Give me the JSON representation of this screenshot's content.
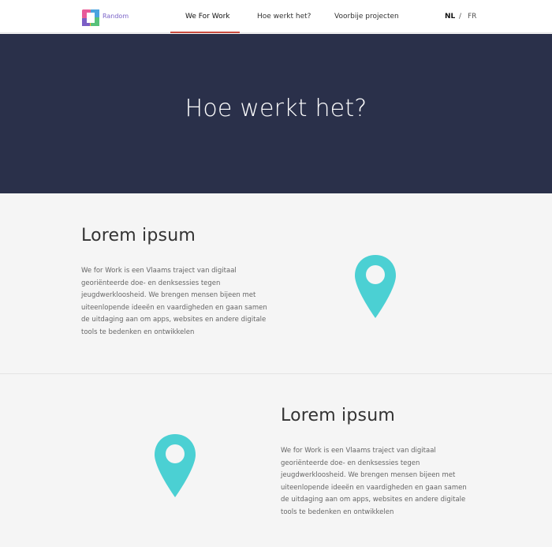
{
  "header": {
    "brand": "Random",
    "nav": [
      {
        "label": "We For Work"
      },
      {
        "label": "Hoe werkt het?"
      },
      {
        "label": "Voorbije projecten"
      }
    ],
    "languages": {
      "nl": "NL",
      "separator": "/",
      "fr": "FR"
    }
  },
  "hero": {
    "title": "Hoe werkt het?"
  },
  "sections": [
    {
      "title": "Lorem ipsum",
      "text": "We for Work is een Vlaams traject van digitaal georiënteerde doe- en denksessies tegen jeugdwerkloosheid. We brengen mensen bijeen met uiteenlopende ideeën en vaardigheden en gaan samen de uitdaging aan om apps, websites en andere digitale tools te bedenken en ontwikkelen"
    },
    {
      "title": "Lorem ipsum",
      "text": "We for Work is een Vlaams traject van digitaal georiënteerde doe- en denksessies tegen jeugdwerkloosheid. We brengen mensen bijeen met uiteenlopende ideeën en vaardigheden en gaan samen de uitdaging aan om apps, websites en andere digitale tools te bedenken en ontwikkelen"
    }
  ],
  "colors": {
    "hero": "#2a304a",
    "pin": "#4bd0d3",
    "active": "#c94c3f",
    "brand": "#7a63c8"
  }
}
